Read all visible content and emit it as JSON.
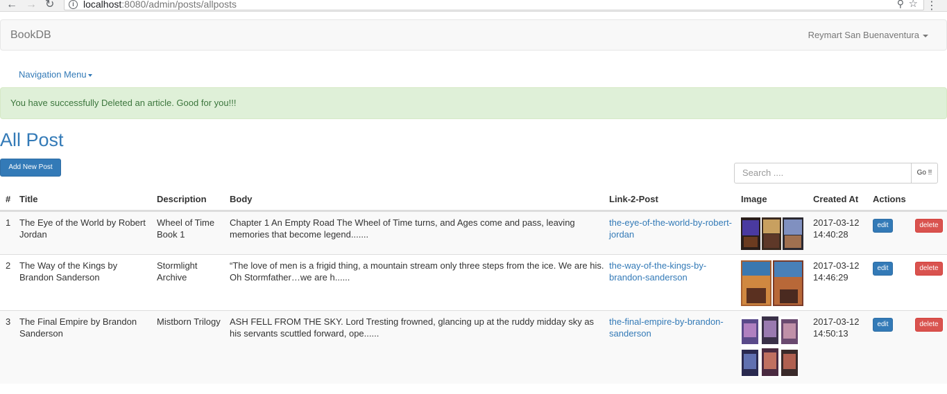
{
  "browser": {
    "url_host": "localhost",
    "url_path": ":8080/admin/posts/allposts"
  },
  "navbar": {
    "brand": "BookDB",
    "user": "Reymart San Buenaventura"
  },
  "nav_menu": "Navigation Menu",
  "alert": "You have successfully Deleted an article. Good for you!!!",
  "page_title": "All Post",
  "add_button": "Add New Post",
  "search": {
    "placeholder": "Search ....",
    "button": "Go !!"
  },
  "table": {
    "headers": [
      "#",
      "Title",
      "Description",
      "Body",
      "Link-2-Post",
      "Image",
      "Created At",
      "Actions"
    ],
    "rows": [
      {
        "num": "1",
        "title": "The Eye of the World by Robert Jordan",
        "description": "Wheel of Time Book 1",
        "body": "Chapter 1 An Empty Road The Wheel of Time turns, and Ages come and pass, leaving memories that become legend.......",
        "link": "the-eye-of-the-world-by-robert-jordan",
        "created": "2017-03-12 14:40:28",
        "edit": "edit",
        "delete": "delete"
      },
      {
        "num": "2",
        "title": "The Way of the Kings by Brandon Sanderson",
        "description": "Stormlight Archive",
        "body": "“The love of men is a frigid thing, a mountain stream only three steps from the ice. We are his. Oh Stormfather…we are h......",
        "link": "the-way-of-the-kings-by-brandon-sanderson",
        "created": "2017-03-12 14:46:29",
        "edit": "edit",
        "delete": "delete"
      },
      {
        "num": "3",
        "title": "The Final Empire by Brandon Sanderson",
        "description": "Mistborn Trilogy",
        "body": "ASH FELL FROM THE SKY. Lord Tresting frowned, glancing up at the ruddy midday sky as his servants scuttled forward, ope......",
        "link": "the-final-empire-by-brandon-sanderson",
        "created": "2017-03-12 14:50:13",
        "edit": "edit",
        "delete": "delete"
      }
    ]
  },
  "colors": {
    "primary": "#337ab7",
    "danger": "#d9534f",
    "success_bg": "#dff0d8",
    "success_text": "#3c763d"
  }
}
